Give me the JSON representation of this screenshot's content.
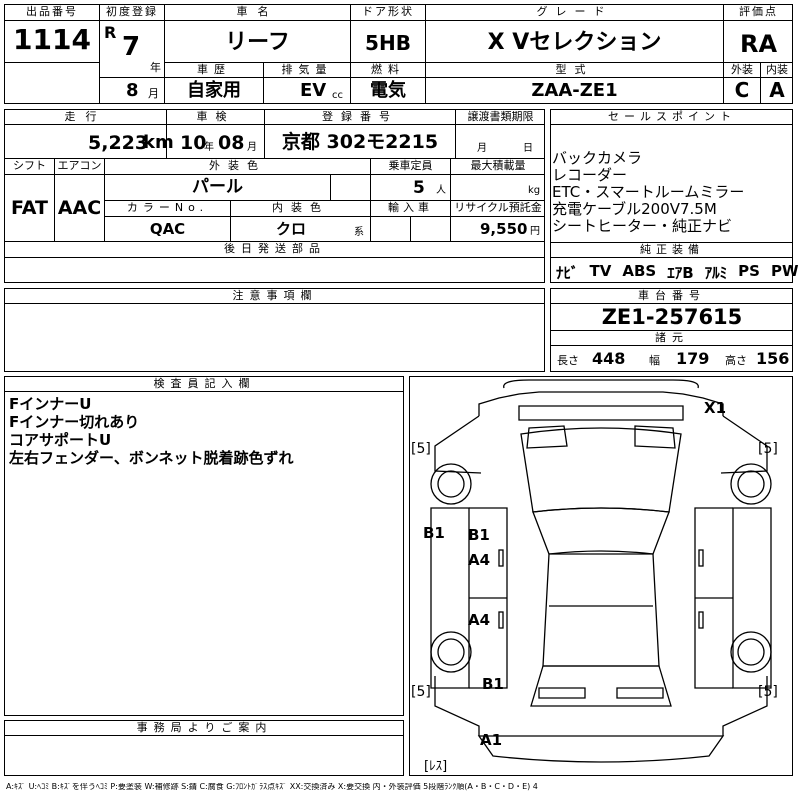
{
  "header": {
    "lot_label": "出品番号",
    "lot_no": "1114",
    "first_reg_label": "初度登録",
    "era": "R",
    "year": "7",
    "year_unit": "年",
    "month": "8",
    "month_unit": "月",
    "name_label": "車名",
    "car_name": "リーフ",
    "door_label": "ドア形状",
    "door": "5HB",
    "grade_label": "グレード",
    "grade": "X Vセレクション",
    "score_label": "評価点",
    "score": "RA",
    "history_label": "車歴",
    "history": "自家用",
    "displacement_label": "排気量",
    "displacement": "EV",
    "displacement_unit": "cc",
    "fuel_label": "燃料",
    "fuel": "電気",
    "model_label": "型式",
    "model": "ZAA-ZE1",
    "exterior_label": "外装",
    "exterior": "C",
    "interior_label": "内装",
    "interior": "A"
  },
  "info": {
    "mileage_label": "走行",
    "mileage": "5,223",
    "mileage_unit": "km",
    "inspection_label": "車検",
    "insp_year": "10",
    "insp_year_unit": "年",
    "insp_month": "08",
    "insp_month_unit": "月",
    "reg_label": "登録番号",
    "reg_no": "京都 302モ2215",
    "transfer_label": "譲渡書類期限",
    "transfer_month": "月",
    "transfer_day": "日",
    "shift_label": "シフト",
    "shift": "FAT",
    "ac_label": "エアコン",
    "ac": "AAC",
    "color_label": "外装色",
    "color": "パール",
    "capacity_label": "乗車定員",
    "capacity": "5",
    "capacity_unit": "人",
    "load_label": "最大積載量",
    "load_unit": "kg",
    "color_no_label": "カラーNo.",
    "color_no": "QAC",
    "int_color_label": "内装色",
    "int_color": "クロ",
    "int_color_unit": "系",
    "import_label": "輸入車",
    "recycle_label": "リサイクル預託金",
    "recycle": "9,550",
    "recycle_unit": "円",
    "later_parts_label": "後日発送部品"
  },
  "sales": {
    "label": "セールスポイント",
    "points": [
      "バックカメラ",
      "レコーダー",
      "ETC・スマートルームミラー",
      "充電ケーブル200V7.5M",
      "シートヒーター・純正ナビ"
    ],
    "equip_label": "純正装備",
    "equip": [
      "ﾅﾋﾞ",
      "TV",
      "ABS",
      "ｴｱB",
      "ｱﾙﾐ",
      "PS",
      "PW"
    ]
  },
  "chassis": {
    "label": "車台番号",
    "number": "ZE1-257615",
    "spec_label": "諸元",
    "length_label": "長さ",
    "length": "448",
    "width_label": "幅",
    "width": "179",
    "height_label": "高さ",
    "height": "156"
  },
  "caution": {
    "label": "注意事項欄"
  },
  "inspector": {
    "label": "検査員記入欄",
    "notes": [
      "FインナーU",
      "Fインナー切れあり",
      "コアサポートU",
      "左右フェンダー、ボンネット脱着跡色ずれ"
    ]
  },
  "office": {
    "label": "事務局よりご案内"
  },
  "diagram": {
    "x1": "X1",
    "tire_fl": "[5]",
    "tire_fr": "[5]",
    "tire_rl": "[5]",
    "tire_rr": "[5]",
    "b1_side": "B1",
    "b1_fender": "B1",
    "a4_front_door": "A4",
    "a4_rear_door": "A4",
    "b1_rear": "B1",
    "a1_rear": "A1",
    "spare": "[ﾚｽ]"
  },
  "legend": {
    "text": "A:ｷｽﾞ U:ﾍｺﾐ B:ｷｽﾞを伴うﾍｺﾐ P:要塗装 W:補修跡 S:錆 C:腐食 G:ﾌﾛﾝﾄｶﾞﾗｽ点ｷｽﾞ XX:交換済み X:要交換 内・外装評価 5段階ﾗﾝｸ順(A・B・C・D・E) 4"
  }
}
